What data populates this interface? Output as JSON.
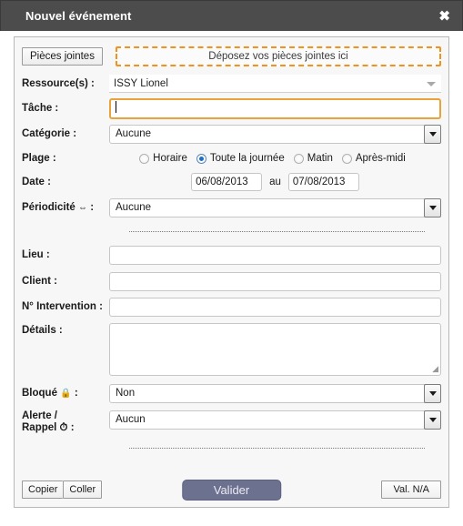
{
  "window": {
    "title": "Nouvel événement",
    "close_label": "✖"
  },
  "attachments": {
    "button_label": "Pièces jointes",
    "dropzone_text": "Déposez vos pièces jointes ici"
  },
  "fields": {
    "resource": {
      "label": "Ressource(s) :",
      "value": "ISSY Lionel"
    },
    "task": {
      "label": "Tâche :",
      "value": "",
      "placeholder": ""
    },
    "category": {
      "label": "Catégorie :",
      "value": "Aucune"
    },
    "range": {
      "label": "Plage :",
      "options": [
        {
          "label": "Horaire",
          "checked": false
        },
        {
          "label": "Toute la journée",
          "checked": true
        },
        {
          "label": "Matin",
          "checked": false
        },
        {
          "label": "Après-midi",
          "checked": false
        }
      ]
    },
    "date": {
      "label": "Date :",
      "start": "06/08/2013",
      "separator": "au",
      "end": "07/08/2013"
    },
    "periodicity": {
      "label": "Périodicité",
      "icon": "⇔",
      "label_suffix": ":",
      "value": "Aucune"
    },
    "place": {
      "label": "Lieu :",
      "value": ""
    },
    "client": {
      "label": "Client :",
      "value": ""
    },
    "intervention": {
      "label": "N° Intervention :",
      "value": ""
    },
    "details": {
      "label": "Détails :",
      "value": ""
    },
    "blocked": {
      "label": "Bloqué",
      "icon": "🔒",
      "label_suffix": ":",
      "value": "Non"
    },
    "alert": {
      "label_line1": "Alerte /",
      "label_line2": "Rappel",
      "icon": "⏱",
      "label_suffix": ":",
      "value": "Aucun"
    }
  },
  "footer": {
    "copy_label": "Copier",
    "paste_label": "Coller",
    "validate_label": "Valider",
    "na_label": "Val. N/A"
  },
  "colors": {
    "titlebar_bg": "#4c4c4c",
    "accent_orange": "#f0921e",
    "focus_border": "#e8a33d",
    "validate_bg": "#6d7190",
    "radio_selected": "#1d6fc4",
    "panel_bg": "#f7f7f7"
  }
}
